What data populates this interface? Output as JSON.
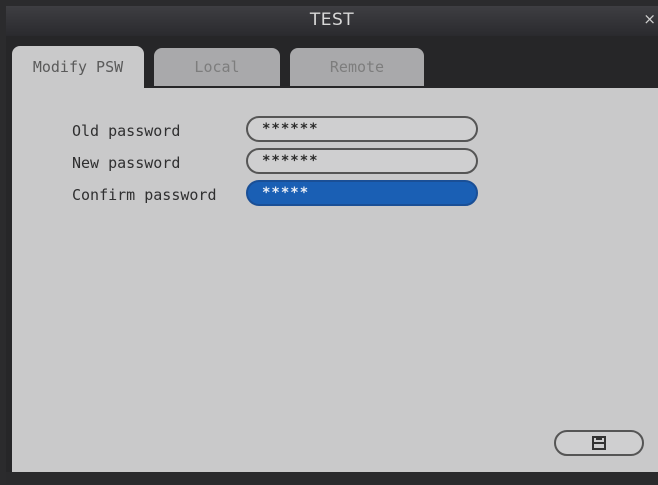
{
  "window": {
    "title": "TEST",
    "close_label": "×"
  },
  "tabs": [
    {
      "label": "Modify PSW",
      "active": true
    },
    {
      "label": "Local",
      "active": false
    },
    {
      "label": "Remote",
      "active": false
    }
  ],
  "form": {
    "old_password": {
      "label": "Old password",
      "value": "******"
    },
    "new_password": {
      "label": "New password",
      "value": "******"
    },
    "confirm_password": {
      "label": "Confirm password",
      "value": "*****"
    }
  },
  "save_button": {
    "icon": "save-icon"
  },
  "colors": {
    "focus_accent": "#1a5fb4",
    "panel_bg": "#c9c9ca",
    "frame_bg": "#262628"
  }
}
